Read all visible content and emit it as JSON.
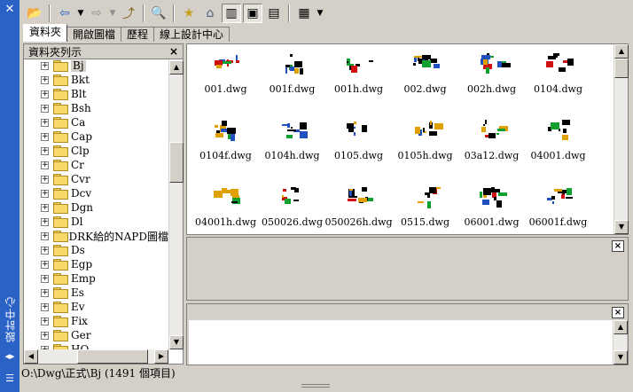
{
  "palette": {
    "sidebar": "#2a62c6",
    "face": "#d4d0c8",
    "folder": "#f9d96b"
  },
  "sidebar": {
    "title": "設計中心",
    "close_icon": "close-icon",
    "autohide_icon": "autohide-icon",
    "properties_icon": "properties-icon"
  },
  "toolbar": {
    "icons": [
      "load-icon",
      "back-icon",
      "dropdown-icon",
      "forward-icon",
      "dropdown-icon",
      "up-icon",
      "search-icon",
      "favorites-icon",
      "home-icon",
      "tree-toggle-icon",
      "preview-icon",
      "description-icon",
      "views-icon",
      "dropdown-icon"
    ]
  },
  "tabs": [
    "資料夾",
    "開啟圖檔",
    "歷程",
    "線上設計中心"
  ],
  "tree": {
    "header": "資料夾列示",
    "close": "×",
    "items": [
      "Bj",
      "Bkt",
      "Blt",
      "Bsh",
      "Ca",
      "Cap",
      "Clp",
      "Cr",
      "Cvr",
      "Dcv",
      "Dgn",
      "Dl",
      "DRK給的NAPD圖檔",
      "Ds",
      "Egp",
      "Emp",
      "Es",
      "Ev",
      "Fix",
      "Ger",
      "HO"
    ]
  },
  "files": [
    "001.dwg",
    "001f.dwg",
    "001h.dwg",
    "002.dwg",
    "002h.dwg",
    "0104.dwg",
    "0104f.dwg",
    "0104h.dwg",
    "0105.dwg",
    "0105h.dwg",
    "03a12.dwg",
    "04001.dwg",
    "04001h.dwg",
    "050026.dwg",
    "050026h.dwg",
    "0515.dwg",
    "06001.dwg",
    "06001f.dwg"
  ],
  "panels": {
    "close": "×"
  },
  "status": "O:\\Dwg\\正式\\Bj  (1491 個項目)"
}
